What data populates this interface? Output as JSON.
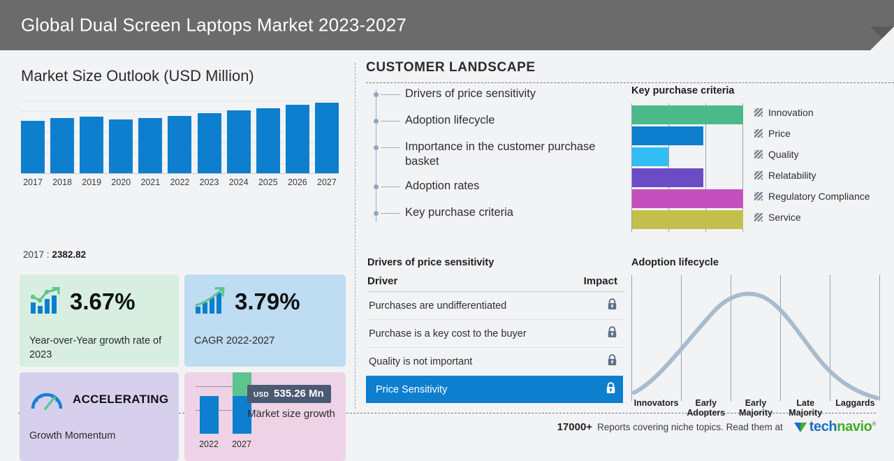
{
  "header": {
    "title": "Global Dual Screen Laptops Market 2023-2027"
  },
  "left": {
    "panel_title": "Market Size Outlook (USD Million)",
    "value_note_year": "2017 :",
    "value_note_value": "2382.82",
    "cards": {
      "yoy": {
        "value": "3.67%",
        "caption": "Year-over-Year growth rate of 2023",
        "icon": "chart-growth-icon"
      },
      "cagr": {
        "value": "3.79%",
        "caption": "CAGR  2022-2027",
        "icon": "bar-arrow-up-icon"
      },
      "momentum": {
        "label": "ACCELERATING",
        "caption": "Growth Momentum",
        "icon": "speedometer-icon"
      },
      "growth": {
        "currency": "USD",
        "value": "535.26 Mn",
        "caption": "Market size growth",
        "x_labels": [
          "2022",
          "2027"
        ]
      }
    }
  },
  "right": {
    "section_heading": "CUSTOMER LANDSCAPE",
    "landscape_items": [
      "Drivers of price sensitivity",
      "Adoption lifecycle",
      "Importance in the customer purchase basket",
      "Adoption rates",
      "Key purchase criteria"
    ],
    "key_purchase_criteria": {
      "title": "Key purchase criteria",
      "items": [
        {
          "label": "Innovation",
          "color": "#4cb98a",
          "pct": 100
        },
        {
          "label": "Price",
          "color": "#0d7fce",
          "pct": 64
        },
        {
          "label": "Quality",
          "color": "#33bdf5",
          "pct": 33
        },
        {
          "label": "Relatability",
          "color": "#6b4cc4",
          "pct": 64
        },
        {
          "label": "Regulatory Compliance",
          "color": "#c450bd",
          "pct": 100
        },
        {
          "label": "Service",
          "color": "#c4bf4c",
          "pct": 100
        }
      ]
    },
    "drivers": {
      "title": "Drivers of price sensitivity",
      "columns": [
        "Driver",
        "Impact"
      ],
      "rows": [
        {
          "driver": "Purchases are undifferentiated",
          "impact_icon": "lock-icon",
          "highlight": false
        },
        {
          "driver": "Purchase is a key cost to the buyer",
          "impact_icon": "lock-icon",
          "highlight": false
        },
        {
          "driver": "Quality is not important",
          "impact_icon": "lock-icon",
          "highlight": false
        },
        {
          "driver": "Price Sensitivity",
          "impact_icon": "lock-icon",
          "highlight": true
        }
      ]
    },
    "adoption": {
      "title": "Adoption lifecycle",
      "stages": [
        "Innovators",
        "Early Adopters",
        "Early Majority",
        "Late Majority",
        "Laggards"
      ]
    }
  },
  "footer": {
    "count": "17000+",
    "text": "Reports covering niche topics. Read them at",
    "logo_part1": "tech",
    "logo_part2": "navio",
    "logo_tm": "®"
  },
  "chart_data": {
    "type": "bar",
    "title": "Market Size Outlook (USD Million)",
    "xlabel": "",
    "ylabel": "USD Million",
    "categories": [
      "2017",
      "2018",
      "2019",
      "2020",
      "2021",
      "2022",
      "2023",
      "2024",
      "2025",
      "2026",
      "2027"
    ],
    "values": [
      2382.82,
      2430.0,
      2455.0,
      2420.0,
      2448.0,
      2490.0,
      2541.4,
      2600.0,
      2652.0,
      2700.0,
      2725.26
    ],
    "bar_heights_pct": [
      72,
      76,
      78,
      74,
      76,
      79,
      83,
      87,
      90,
      94,
      97
    ],
    "ylim": [
      0,
      2820
    ],
    "grid": true,
    "legend": "none",
    "color": "#0d7fce",
    "annotation": "2017 : 2382.82"
  }
}
